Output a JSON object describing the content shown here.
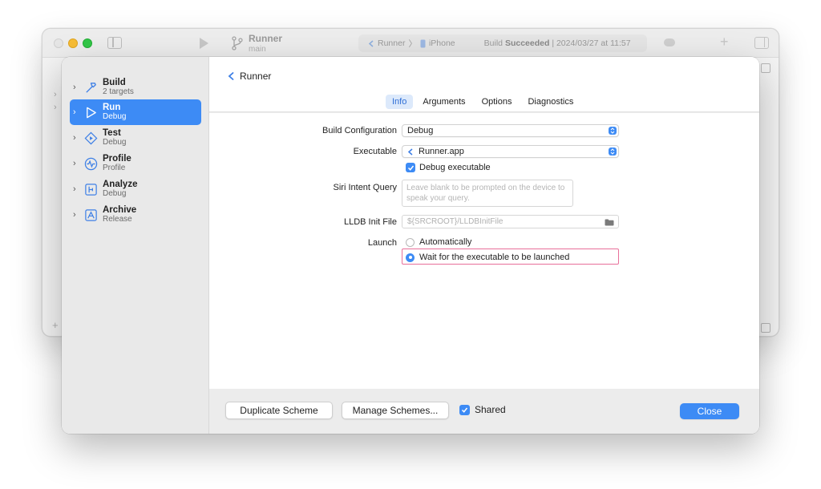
{
  "background_window": {
    "project_name": "Runner",
    "branch": "main",
    "destination_scheme": "Runner",
    "destination_device": "iPhone",
    "status_prefix": "Build",
    "status_bold": "Succeeded",
    "status_suffix": "| 2024/03/27 at 11:57"
  },
  "sidebar": {
    "items": [
      {
        "name": "Build",
        "sub": "2 targets"
      },
      {
        "name": "Run",
        "sub": "Debug"
      },
      {
        "name": "Test",
        "sub": "Debug"
      },
      {
        "name": "Profile",
        "sub": "Profile"
      },
      {
        "name": "Analyze",
        "sub": "Debug"
      },
      {
        "name": "Archive",
        "sub": "Release"
      }
    ]
  },
  "header": {
    "breadcrumb": "Runner",
    "tabs": [
      "Info",
      "Arguments",
      "Options",
      "Diagnostics"
    ],
    "active_tab": "Info"
  },
  "form": {
    "build_configuration": {
      "label": "Build Configuration",
      "value": "Debug"
    },
    "executable": {
      "label": "Executable",
      "value": "Runner.app"
    },
    "debug_executable": {
      "label": "Debug executable",
      "checked": true
    },
    "siri_intent_query": {
      "label": "Siri Intent Query",
      "placeholder": "Leave blank to be prompted on the device to speak your query."
    },
    "lldb_init_file": {
      "label": "LLDB Init File",
      "placeholder": "${SRCROOT}/LLDBInitFile"
    },
    "launch": {
      "label": "Launch",
      "options": [
        "Automatically",
        "Wait for the executable to be launched"
      ],
      "selected": "Wait for the executable to be launched"
    }
  },
  "footer": {
    "duplicate_label": "Duplicate Scheme",
    "manage_label": "Manage Schemes...",
    "shared_label": "Shared",
    "shared_checked": true,
    "close_label": "Close"
  },
  "colors": {
    "accent": "#3d8bf5",
    "highlight": "#e8709a",
    "sidebar_bg": "#e9e9e9"
  }
}
